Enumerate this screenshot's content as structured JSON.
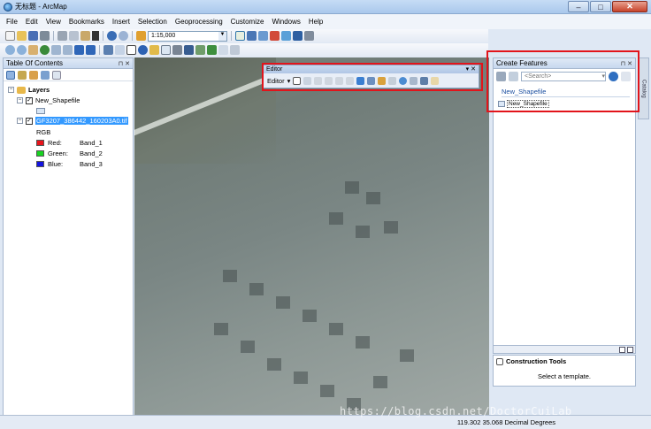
{
  "window": {
    "title": "无标题 - ArcMap",
    "min": "–",
    "max": "□",
    "close": "✕"
  },
  "menu": [
    "File",
    "Edit",
    "View",
    "Bookmarks",
    "Insert",
    "Selection",
    "Geoprocessing",
    "Customize",
    "Windows",
    "Help"
  ],
  "toolbar": {
    "scale": "1:15,000"
  },
  "toc": {
    "title": "Table Of Contents",
    "layers_label": "Layers",
    "shapefile": "New_Shapefile",
    "raster": "GF3207_386442_160203A0.tif",
    "renderer": "RGB",
    "bands": [
      {
        "channel": "Red:",
        "band": "Band_1",
        "color": "#e8141b"
      },
      {
        "channel": "Green:",
        "band": "Band_2",
        "color": "#17d320"
      },
      {
        "channel": "Blue:",
        "band": "Band_3",
        "color": "#1414e0"
      }
    ]
  },
  "editor": {
    "title": "Editor",
    "menu_label": "Editor"
  },
  "create_features": {
    "title": "Create Features",
    "search_placeholder": "<Search>",
    "group": "New_Shapefile",
    "template": "New_Shapefile"
  },
  "side_tab": "Catalog",
  "construction_tools": {
    "title": "Construction Tools",
    "message": "Select a template."
  },
  "status": {
    "coords": "119.302  35.068 Decimal Degrees"
  },
  "watermark": "https://blog.csdn.net/DoctorCuiLab",
  "colors": {
    "highlight_box": "#e2141b",
    "selection": "#3399ff"
  }
}
